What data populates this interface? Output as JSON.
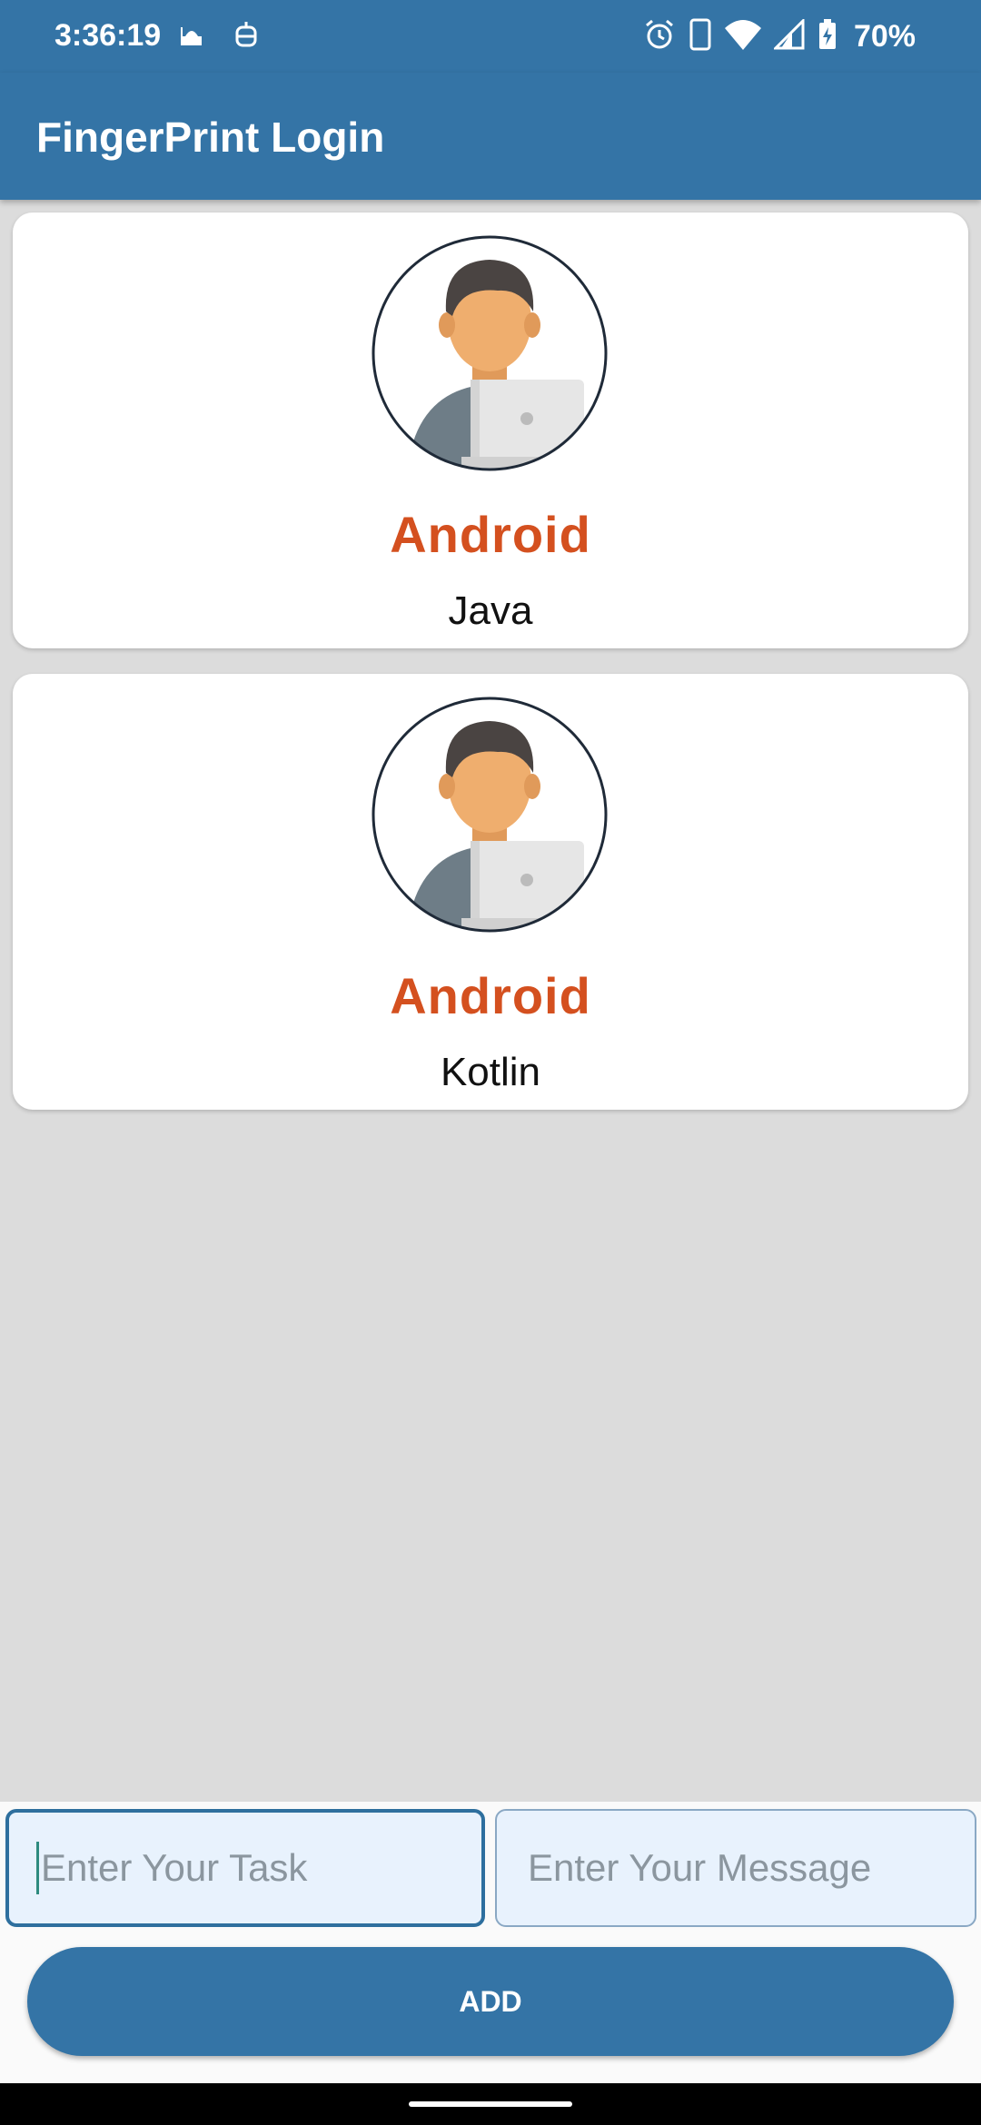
{
  "status_bar": {
    "time": "3:36:19",
    "battery": "70%",
    "icons_left": [
      "mosque-icon",
      "robot-icon"
    ],
    "icons_right": [
      "alarm-icon",
      "phone-icon",
      "wifi-icon",
      "signal-icon",
      "battery-charging-icon"
    ]
  },
  "app_bar": {
    "title": "FingerPrint Login"
  },
  "cards": [
    {
      "title": "Android",
      "subtitle": "Java",
      "icon": "developer-avatar-icon"
    },
    {
      "title": "Android",
      "subtitle": "Kotlin",
      "icon": "developer-avatar-icon"
    }
  ],
  "form": {
    "task_placeholder": "Enter Your Task",
    "message_placeholder": "Enter Your Message",
    "add_label": "ADD"
  },
  "colors": {
    "primary": "#3474a6",
    "accent": "#d4501f",
    "background": "#dcdcdc",
    "field_bg": "#e8f2fd"
  }
}
